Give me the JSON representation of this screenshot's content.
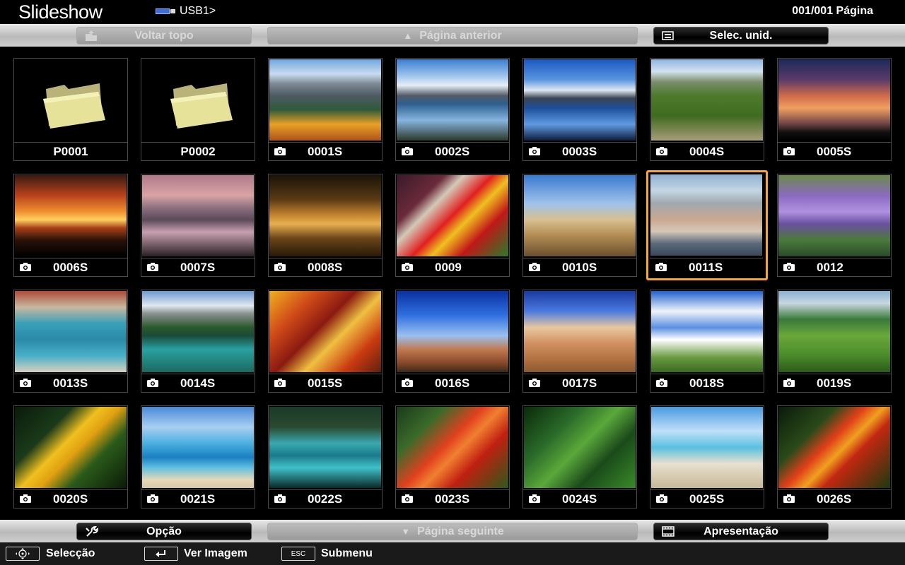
{
  "title": "Slideshow",
  "source": "USB1>",
  "page_counter": "001/001 Página",
  "top_bar": {
    "back_top": "Voltar topo",
    "prev_page": "Página anterior",
    "select_unit": "Selec. unid."
  },
  "bottom_bar": {
    "option": "Opção",
    "next_page": "Página seguinte",
    "presentation": "Apresentação"
  },
  "footer": {
    "select": "Selecção",
    "view_image": "Ver Imagem",
    "esc_key": "ESC",
    "submenu": "Submenu"
  },
  "items": [
    {
      "label": "P0001",
      "kind": "folder"
    },
    {
      "label": "P0002",
      "kind": "folder"
    },
    {
      "label": "0001S",
      "kind": "photo",
      "scene": "mountains-flowers"
    },
    {
      "label": "0002S",
      "kind": "photo",
      "scene": "mountain-lake"
    },
    {
      "label": "0003S",
      "kind": "photo",
      "scene": "matterhorn-lake"
    },
    {
      "label": "0004S",
      "kind": "photo",
      "scene": "vineyard"
    },
    {
      "label": "0005S",
      "kind": "photo",
      "scene": "sunset-clouds"
    },
    {
      "label": "0006S",
      "kind": "photo",
      "scene": "sunset"
    },
    {
      "label": "0007S",
      "kind": "photo",
      "scene": "river-dusk"
    },
    {
      "label": "0008S",
      "kind": "photo",
      "scene": "night-street"
    },
    {
      "label": "0009",
      "kind": "photo",
      "scene": "peppers"
    },
    {
      "label": "0010S",
      "kind": "photo",
      "scene": "castle"
    },
    {
      "label": "0011S",
      "kind": "photo",
      "scene": "coastal-town",
      "selected": true
    },
    {
      "label": "0012",
      "kind": "photo",
      "scene": "lavender"
    },
    {
      "label": "0013S",
      "kind": "photo",
      "scene": "harbor"
    },
    {
      "label": "0014S",
      "kind": "photo",
      "scene": "alpine-lake"
    },
    {
      "label": "0015S",
      "kind": "photo",
      "scene": "autumn-leaves"
    },
    {
      "label": "0016S",
      "kind": "photo",
      "scene": "desert-arch"
    },
    {
      "label": "0017S",
      "kind": "photo",
      "scene": "canyon-hoodoos"
    },
    {
      "label": "0018S",
      "kind": "photo",
      "scene": "cloudy-field"
    },
    {
      "label": "0019S",
      "kind": "photo",
      "scene": "green-hills"
    },
    {
      "label": "0020S",
      "kind": "photo",
      "scene": "yellow-flower"
    },
    {
      "label": "0021S",
      "kind": "photo",
      "scene": "beach-sailboat"
    },
    {
      "label": "0022S",
      "kind": "photo",
      "scene": "forest-lake"
    },
    {
      "label": "0023S",
      "kind": "photo",
      "scene": "red-flowers"
    },
    {
      "label": "0024S",
      "kind": "photo",
      "scene": "jungle-ferns"
    },
    {
      "label": "0025S",
      "kind": "photo",
      "scene": "driftwood-beach"
    },
    {
      "label": "0026S",
      "kind": "photo",
      "scene": "red-lily"
    }
  ],
  "colors": {
    "selection": "#f6a53a"
  }
}
